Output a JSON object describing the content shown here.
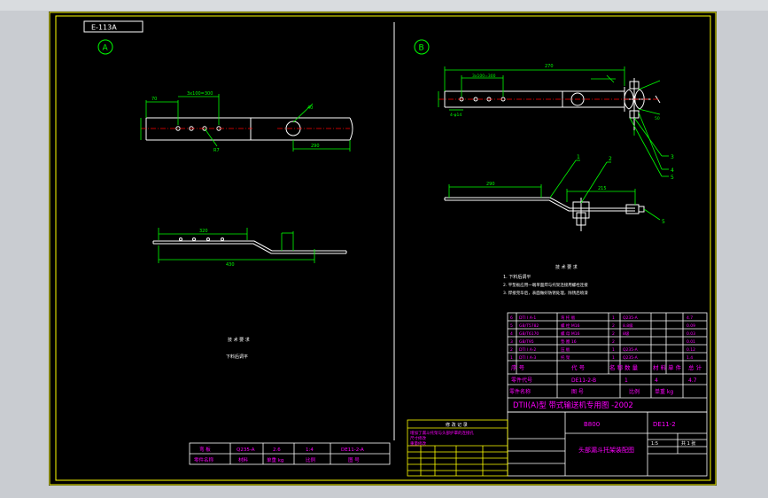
{
  "colors": {
    "background": "#000000",
    "frame": "#ffff00",
    "part_lines": "#ffffff",
    "dimensions": "#00ff00",
    "table_text": "#ff00ff",
    "annotations": "#00ffff"
  },
  "drawing_code": "E-113A",
  "view_a_label": "A",
  "view_b_label": "B",
  "left_notes": {
    "heading": "技 术 要 求",
    "line1": "下料后调平"
  },
  "right_notes": {
    "heading": "技 术 要 求",
    "line1": "1. 下料后调平",
    "line2": "2. 平垫板应用一端单面焊与托架连接用螺栓连接",
    "line3": "3. 焊接完毕后，表面做好防锈处理，除锈后喷漆"
  },
  "dims_a": {
    "d1": "70",
    "d2": "3x100=300",
    "d3": "R7",
    "d4": "290",
    "d5": "320",
    "d6": "430",
    "d7": "40"
  },
  "dims_b": {
    "d1": "270",
    "d2": "3x100=300",
    "d3": "4-φ14",
    "d4": "290",
    "d5": "215",
    "d6": "50"
  },
  "callouts": [
    "1",
    "2",
    "3",
    "4",
    "5"
  ],
  "bom_rows": [
    [
      "6",
      "DTI I A-1",
      "弯 托 板",
      "1",
      "Q235-A",
      "",
      "4.7"
    ],
    [
      "5",
      "GB/T5782",
      "螺 栓 M16",
      "2",
      "8.8级",
      "",
      "0.09"
    ],
    [
      "4",
      "GB/T6170",
      "螺 母 M16",
      "2",
      "8级",
      "",
      "0.03"
    ],
    [
      "3",
      "GB/T95",
      "垫 圈 16",
      "2",
      "",
      "",
      "0.01"
    ],
    [
      "2",
      "DTI I A-2",
      "压 板",
      "1",
      "Q235-A",
      "",
      "0.12"
    ],
    [
      "1",
      "DTI I A-3",
      "托 架",
      "1",
      "Q235-A",
      "",
      "1.4"
    ]
  ],
  "bom_header": [
    "序 号",
    "代 号",
    "名 称",
    "数 量",
    "材 料",
    "单 件",
    "总 计"
  ],
  "bom_header2": [
    "零件代号",
    "DE11-2-B",
    "1",
    "4",
    "4.7"
  ],
  "title_block": {
    "main_title": "DTII(A)型 带式输送机专用图 -2002",
    "code": "B800",
    "drawing_no": "DE11-2",
    "part_name": "头部漏斗托架装配图",
    "scale": "1:5",
    "sheet": "共 1 张"
  },
  "change_table": {
    "heading": "修 改 记 录",
    "lines": [
      "增加了漏斗托架与头部护罩的连接孔",
      "尺寸修改",
      "重量修改"
    ]
  },
  "small_table": {
    "row1": [
      "弯 板",
      "Q235-A",
      "2.6",
      "1:4",
      "DE11-2-A"
    ],
    "row2": [
      "零件名称",
      "材料",
      "单重 kg",
      "比例",
      "图 号"
    ]
  }
}
